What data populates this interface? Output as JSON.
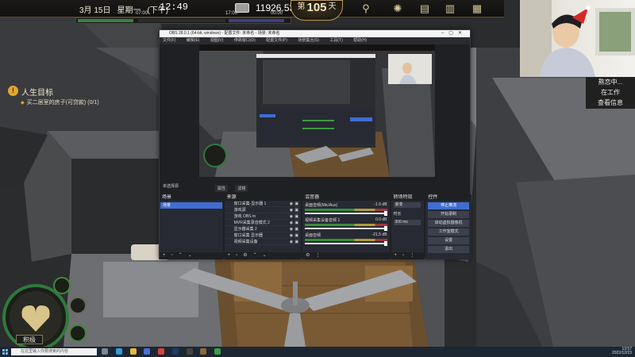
{
  "game_hud": {
    "date": "3月 15日",
    "weekday": "星期一",
    "period": "(下午)",
    "time": "12:49",
    "money": "11926.53",
    "day_prefix": "第",
    "day_number": "105",
    "day_suffix": "天",
    "timebar_ticks": [
      "07:00",
      "17:00",
      "00:00"
    ],
    "icons": [
      "person-search-icon",
      "brain-icon",
      "document-icon",
      "clipboard-icon",
      "phone-icon",
      "book-icon"
    ]
  },
  "life_goal": {
    "title": "人生目标",
    "task": "买二居室的房子(可贷款) (0/1)"
  },
  "webcam_status": {
    "line1": "熬恋中...",
    "line2": "在工作",
    "line3": "查看信息"
  },
  "character": {
    "mood_label": "积极"
  },
  "obs": {
    "title": "OBS 28.0.1 (64-bit, windows) - 配置文件: 未命名 - 场景: 未命名",
    "menu": [
      "文件(F)",
      "编辑(E)",
      "视图(V)",
      "停靠窗口(D)",
      "配置文件(P)",
      "场景集合(S)",
      "工具(T)",
      "帮助(H)"
    ],
    "preview_label": "未选择源",
    "mode_buttons": [
      "属性",
      "滤镜"
    ],
    "docks": {
      "scenes": {
        "title": "场景",
        "items": [
          "场景"
        ]
      },
      "sources": {
        "title": "来源",
        "items": [
          "窗口采集-显示器 1",
          "游戏源",
          "游戏 OBS m",
          "MVR采集录音模式 2",
          "显示器采集 2",
          "窗口采集 显示器",
          "视频采集设备"
        ]
      },
      "mixer": {
        "title": "混音器",
        "tracks": [
          {
            "name": "桌面音频(Mic/Aux)",
            "db": "-1.6 dB"
          },
          {
            "name": "视频采集设备音频 1",
            "db": "0.0 dB"
          },
          {
            "name": "桌面音频",
            "db": "-21.5 dB"
          }
        ]
      },
      "transitions": {
        "title": "转场特效",
        "type": "渐变",
        "duration_label": "时长",
        "duration": "300 ms"
      },
      "controls": {
        "title": "控件",
        "buttons": [
          "停止推流",
          "开始录制",
          "启动虚拟摄像机",
          "工作室模式",
          "设置",
          "退出"
        ]
      }
    }
  },
  "taskbar": {
    "search_placeholder": "在这里输入你要搜索的内容",
    "time": "13:57",
    "date": "2022/12/23"
  }
}
